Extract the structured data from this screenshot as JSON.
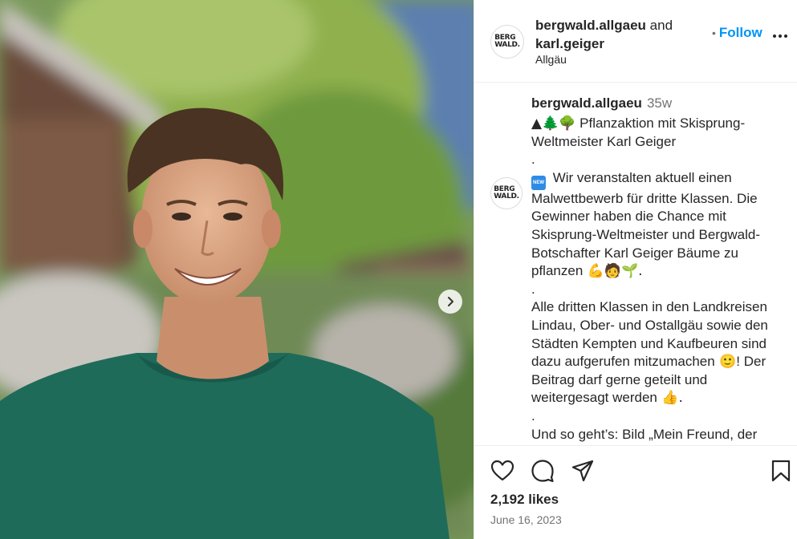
{
  "post": {
    "header": {
      "account": "bergwald.allgaeu",
      "conjunction": "and",
      "coauthor": "karl.geiger",
      "location": "Allgäu",
      "follow_separator": "•",
      "follow_label": "Follow",
      "avatar_logo_line1": "BERG",
      "avatar_logo_line2": "WALD."
    },
    "caption": {
      "username": "bergwald.allgaeu",
      "time": "35w",
      "line1_emoji": "▲🌲🌳",
      "line1_text": " Pflanzaktion mit Skisprung-Weltmeister Karl Geiger",
      "sep": ".",
      "new_badge": "NEW",
      "para2": " Wir veranstalten aktuell einen Malwettbewerb für dritte Klassen. Die Gewinner haben die Chance mit Skisprung-Weltmeister und Bergwald-Botschafter Karl Geiger Bäume zu pflanzen",
      "para2_emoji": " 💪🧑🌱.",
      "para3": "Alle dritten Klassen in den Landkreisen Lindau, Ober- und Ostallgäu sowie den Städten Kempten und Kaufbeuren sind dazu aufgerufen mitzumachen",
      "para3_emoji": " 🙂",
      "para3b": "! Der Beitrag darf gerne geteilt und weitergesagt werden",
      "para3b_emoji": " 👍.",
      "para4": "Und so geht’s: Bild „Mein Freund, der Bergwald“ malen ✏ und hinschicken"
    },
    "likes": "2,192 likes",
    "date": "June 16, 2023",
    "icons": {
      "like": "heart-icon",
      "comment": "comment-icon",
      "share": "share-icon",
      "save": "bookmark-icon",
      "more": "more-icon",
      "next": "chevron-right-icon"
    }
  }
}
